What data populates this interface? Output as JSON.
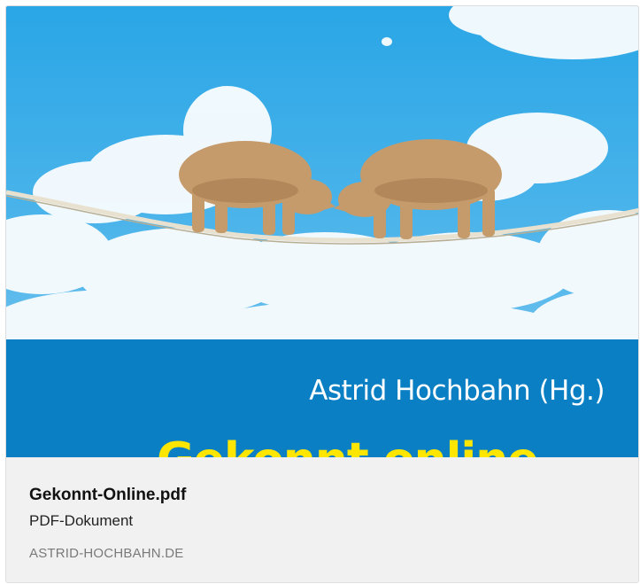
{
  "attachment": {
    "file_name": "Gekonnt-Online.pdf",
    "file_type": "PDF-Dokument",
    "source_domain": "ASTRID-HOCHBAHN.DE"
  },
  "cover": {
    "author": "Astrid Hochbahn (Hg.)",
    "title": "Gekonnt online",
    "illustration": "two-rhinos-on-tightrope",
    "colors": {
      "sky": "#2aa6e6",
      "band": "#0a7fc4",
      "title": "#ffe600",
      "author": "#ffffff"
    }
  }
}
